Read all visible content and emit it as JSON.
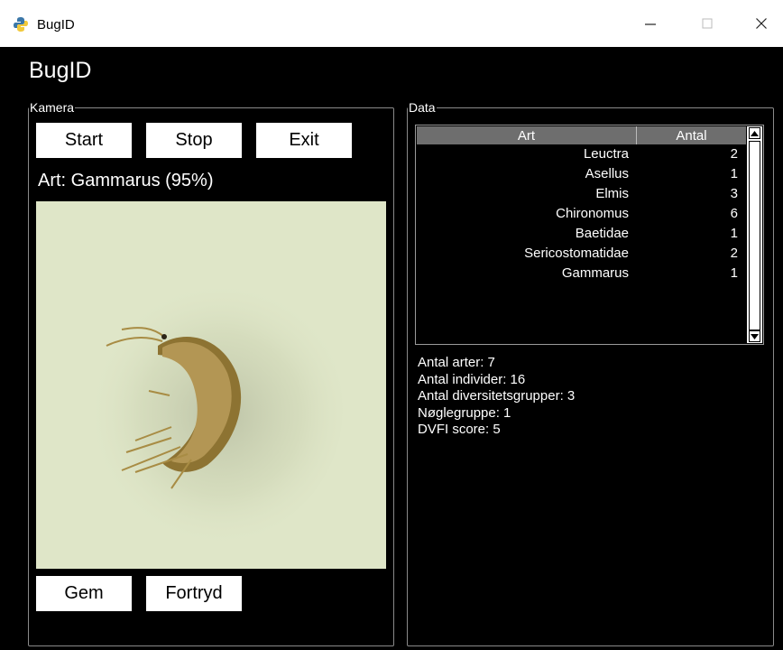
{
  "window": {
    "title": "BugID",
    "icons": {
      "app": "python-icon",
      "minimize": "minimize-icon",
      "maximize": "maximize-icon",
      "close": "close-icon"
    }
  },
  "app": {
    "heading": "BugID"
  },
  "camera": {
    "legend": "Kamera",
    "start_label": "Start",
    "stop_label": "Stop",
    "exit_label": "Exit",
    "species_text": "Art: Gammarus  (95%)",
    "save_label": "Gem",
    "undo_label": "Fortryd"
  },
  "data": {
    "legend": "Data",
    "columns": {
      "art": "Art",
      "antal": "Antal"
    },
    "rows": [
      {
        "art": "Leuctra",
        "antal": "2"
      },
      {
        "art": "Asellus",
        "antal": "1"
      },
      {
        "art": "Elmis",
        "antal": "3"
      },
      {
        "art": "Chironomus",
        "antal": "6"
      },
      {
        "art": "Baetidae",
        "antal": "1"
      },
      {
        "art": "Sericostomatidae",
        "antal": "2"
      },
      {
        "art": "Gammarus",
        "antal": "1"
      }
    ],
    "stats": [
      "Antal arter: 7",
      "Antal individer: 16",
      "Antal diversitetsgrupper: 3",
      "Nøglegruppe: 1",
      "DVFI score: 5"
    ]
  },
  "colors": {
    "window_bg": "#000000",
    "header_bg": "#6e6e6e",
    "camera_bg": "#dfe6c8"
  }
}
